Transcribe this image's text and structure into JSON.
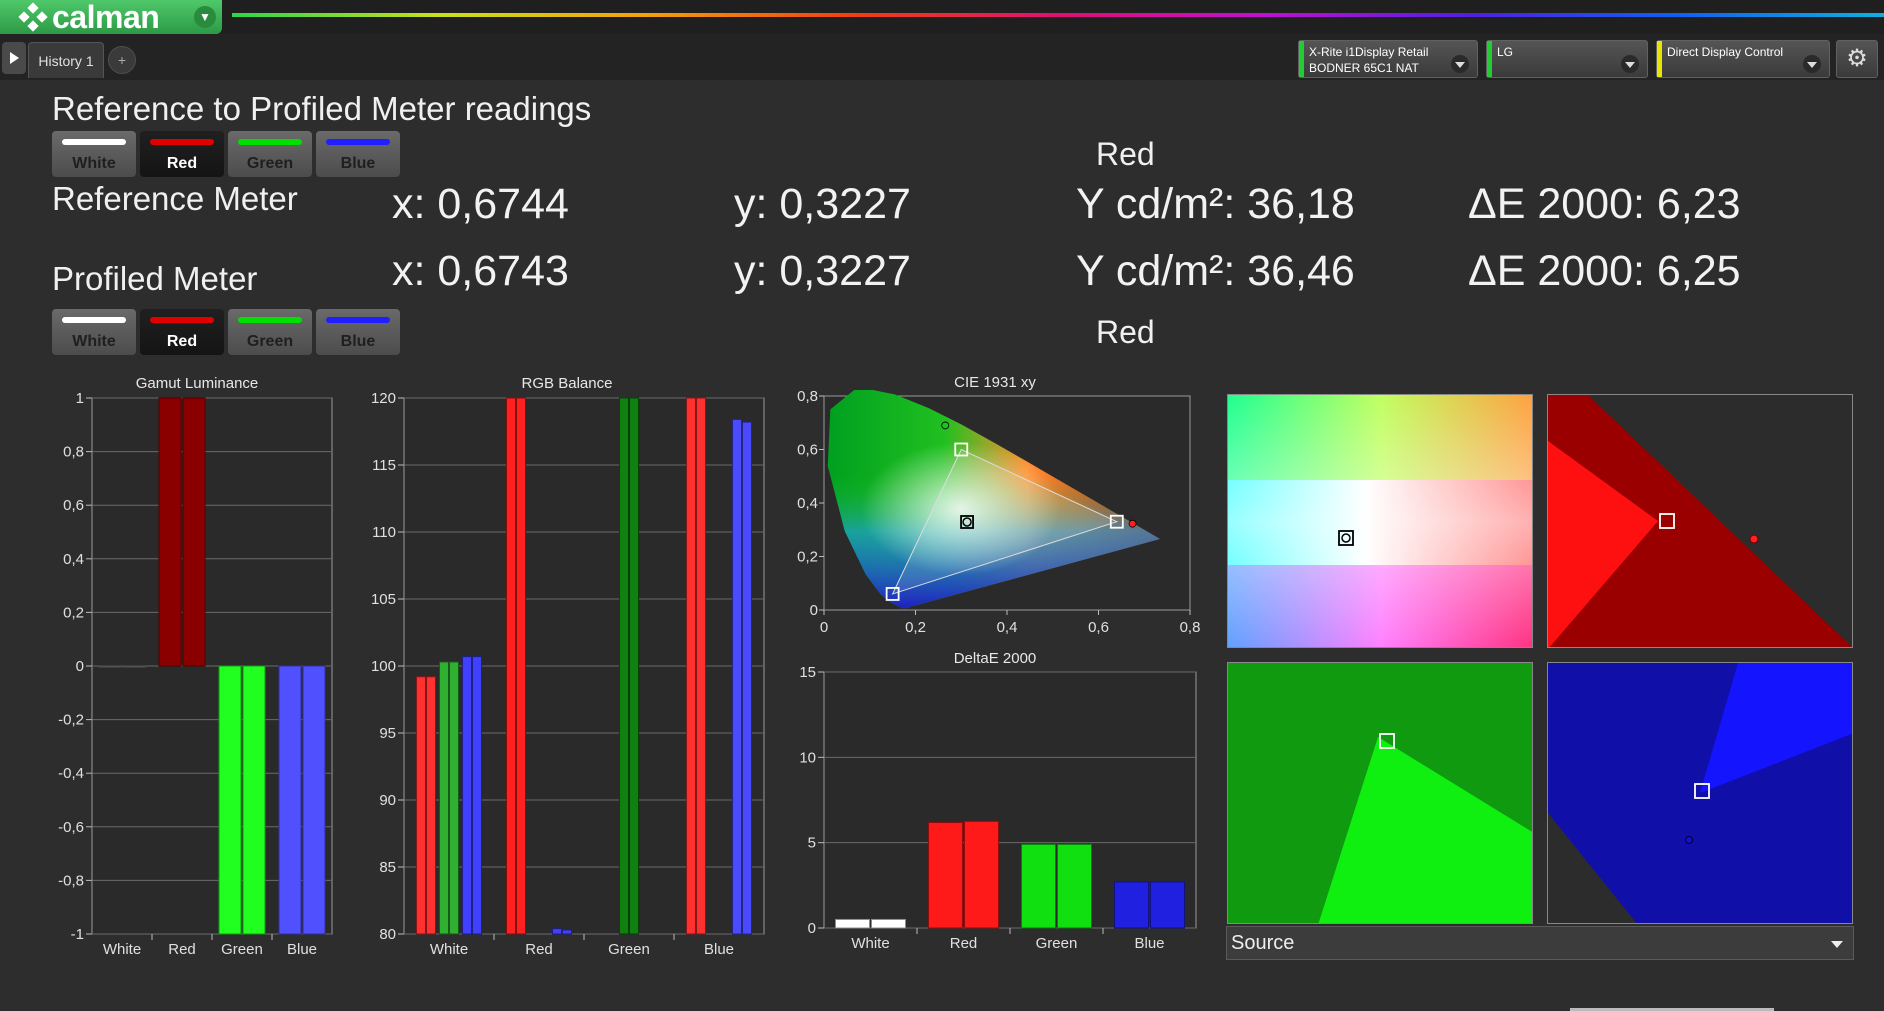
{
  "app": {
    "logo": "calman"
  },
  "tabs": [
    {
      "label": "History 1"
    }
  ],
  "add_tab": "+",
  "devices": [
    {
      "line1": "X-Rite i1Display Retail",
      "line2": "BODNER 65C1 NAT",
      "color": "#22cc33"
    },
    {
      "line1": "LG",
      "line2": "",
      "color": "#22cc33"
    },
    {
      "line1": "Direct Display Control",
      "line2": "",
      "color": "#e6e600"
    }
  ],
  "panel": {
    "title": "Reference to Profiled Meter readings",
    "swatches": [
      {
        "label": "White",
        "color": "#ffffff"
      },
      {
        "label": "Red",
        "color": "#e00000"
      },
      {
        "label": "Green",
        "color": "#00e000"
      },
      {
        "label": "Blue",
        "color": "#2020ff"
      }
    ],
    "active_swatch": "Red",
    "color_name_top": "Red",
    "color_name_bottom": "Red",
    "reference": {
      "label": "Reference Meter",
      "x": "x: 0,6744",
      "y": "y: 0,3227",
      "Y": "Y cd/m²: 36,18",
      "dE": "ΔE 2000: 6,23"
    },
    "profiled": {
      "label": "Profiled Meter",
      "x": "x: 0,6743",
      "y": "y: 0,3227",
      "Y": "Y cd/m²: 36,46",
      "dE": "ΔE 2000: 6,25"
    }
  },
  "chart_data": [
    {
      "type": "bar",
      "title": "Gamut Luminance",
      "categories": [
        "White",
        "Red",
        "Green",
        "Blue"
      ],
      "ylim": [
        -1,
        1
      ],
      "yticks": [
        "1",
        "0,8",
        "0,6",
        "0,4",
        "0,2",
        "0",
        "-0,2",
        "-0,4",
        "-0,6",
        "-0,8",
        "-1"
      ],
      "series": [
        {
          "values": [
            0,
            1,
            -1,
            -1
          ]
        },
        {
          "values": [
            0,
            1,
            -1,
            -1
          ]
        }
      ]
    },
    {
      "type": "bar",
      "title": "RGB Balance",
      "categories": [
        "White",
        "Red",
        "Green",
        "Blue"
      ],
      "ylim": [
        80,
        120
      ],
      "yticks": [
        "120",
        "115",
        "110",
        "105",
        "100",
        "95",
        "90",
        "85",
        "80"
      ],
      "bars": [
        {
          "category": "White",
          "values": [
            99.2,
            99.2
          ],
          "color": "#ff3030"
        },
        {
          "category": "White",
          "values": [
            100.3,
            100.3
          ],
          "color": "#30b030"
        },
        {
          "category": "White",
          "values": [
            100.7,
            100.7
          ],
          "color": "#4040ff"
        },
        {
          "category": "Red",
          "values": [
            120,
            120
          ],
          "color": "#ff2020"
        },
        {
          "category": "Red",
          "values": [
            80,
            80
          ],
          "color": "#20a020"
        },
        {
          "category": "Red",
          "values": [
            80.4,
            80.3
          ],
          "color": "#4040ff"
        },
        {
          "category": "Green",
          "values": [
            80,
            80
          ],
          "color": "#ff2020"
        },
        {
          "category": "Green",
          "values": [
            120,
            120
          ],
          "color": "#108010"
        },
        {
          "category": "Green",
          "values": [
            80,
            80
          ],
          "color": "#4040ff"
        },
        {
          "category": "Blue",
          "values": [
            120,
            120
          ],
          "color": "#ff3030"
        },
        {
          "category": "Blue",
          "values": [
            80,
            80
          ],
          "color": "#20a020"
        },
        {
          "category": "Blue",
          "values": [
            118.4,
            118.2
          ],
          "color": "#4a4aff"
        }
      ]
    },
    {
      "type": "scatter",
      "title": "CIE 1931 xy",
      "xlim": [
        0,
        0.8
      ],
      "ylim": [
        0,
        0.8
      ],
      "xticks": [
        "0",
        "0,2",
        "0,4",
        "0,6",
        "0,8"
      ],
      "yticks": [
        "0,8",
        "0,6",
        "0,4",
        "0,2",
        "0"
      ],
      "targets": [
        {
          "name": "Red",
          "x": 0.64,
          "y": 0.33
        },
        {
          "name": "Green",
          "x": 0.3,
          "y": 0.6
        },
        {
          "name": "Blue",
          "x": 0.15,
          "y": 0.06
        },
        {
          "name": "White",
          "x": 0.3127,
          "y": 0.329
        }
      ],
      "measured": [
        {
          "name": "Red",
          "x": 0.6744,
          "y": 0.3227
        },
        {
          "name": "Green",
          "x": 0.265,
          "y": 0.69
        },
        {
          "name": "White",
          "x": 0.3127,
          "y": 0.329
        }
      ]
    },
    {
      "type": "bar",
      "title": "DeltaE 2000",
      "categories": [
        "White",
        "Red",
        "Green",
        "Blue"
      ],
      "ylim": [
        0,
        15
      ],
      "yticks": [
        "15",
        "10",
        "5",
        "0"
      ],
      "colors": [
        "#ffffff",
        "#ff1a1a",
        "#10e010",
        "#2020e0"
      ],
      "series": [
        {
          "values": [
            0.5,
            6.18,
            4.9,
            2.7
          ]
        },
        {
          "values": [
            0.5,
            6.25,
            4.9,
            2.7
          ]
        }
      ]
    }
  ],
  "source_select": {
    "value": "Source"
  }
}
